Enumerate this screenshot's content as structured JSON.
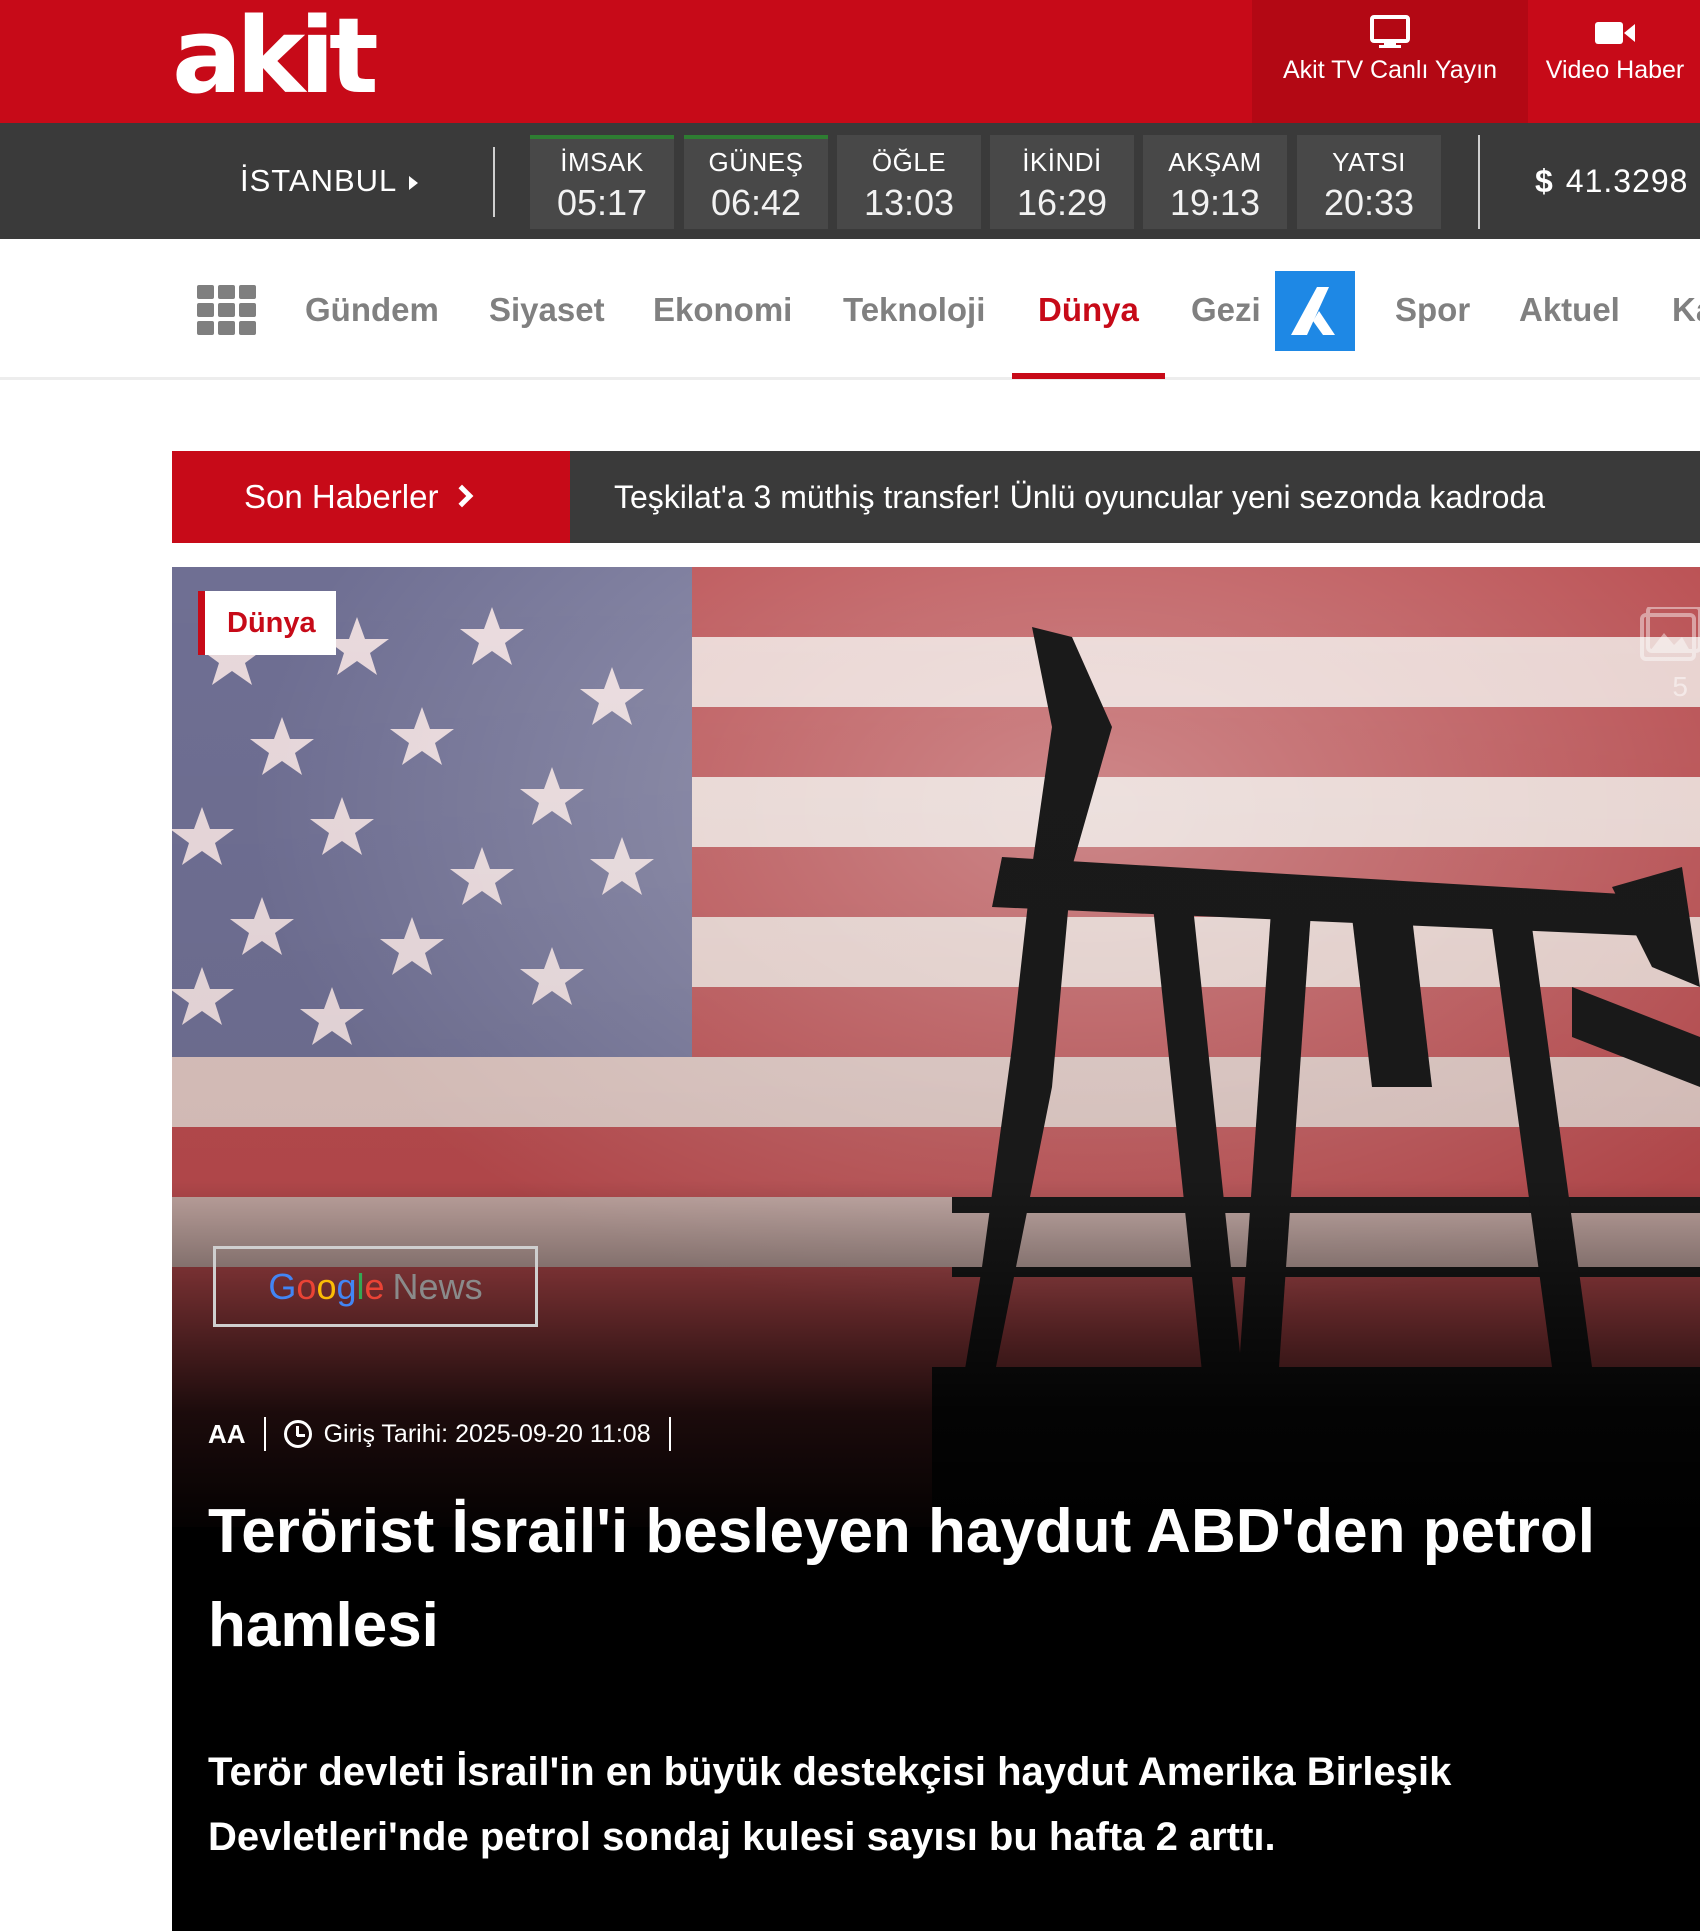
{
  "header": {
    "logo_text": "akit",
    "tv_label": "Akit TV Canlı Yayın",
    "video_label": "Video Haber",
    "tv_icon": "monitor-icon",
    "video_icon": "video-camera-icon",
    "brand_color": "#c70a18"
  },
  "prayer": {
    "city": "İSTANBUL",
    "times": [
      {
        "name": "İMSAK",
        "time": "05:17"
      },
      {
        "name": "GÜNEŞ",
        "time": "06:42"
      },
      {
        "name": "ÖĞLE",
        "time": "13:03"
      },
      {
        "name": "İKİNDİ",
        "time": "16:29"
      },
      {
        "name": "AKŞAM",
        "time": "19:13"
      },
      {
        "name": "YATSI",
        "time": "20:33"
      }
    ],
    "currency_symbol": "$",
    "currency_value": "41.3298"
  },
  "nav": {
    "items": [
      "Gündem",
      "Siyaset",
      "Ekonomi",
      "Teknoloji",
      "Dünya",
      "Gezi",
      "Spor",
      "Aktuel",
      "Ka"
    ],
    "active": "Dünya"
  },
  "ticker": {
    "label": "Son Haberler",
    "text": "Teşkilat'a 3 müthiş transfer! Ünlü oyuncular yeni sezonda kadroda"
  },
  "article": {
    "category": "Dünya",
    "gallery_count": "5",
    "google": "Google",
    "news": "News",
    "source": "AA",
    "date": "Giriş Tarihi: 2025-09-20 11:08",
    "headline": "Terörist İsrail'i besleyen haydut ABD'den petrol hamlesi",
    "summary": "Terör devleti İsrail'in en büyük destekçisi haydut Amerika Birleşik Devletleri'nde petrol sondaj kulesi sayısı bu hafta 2 arttı."
  }
}
